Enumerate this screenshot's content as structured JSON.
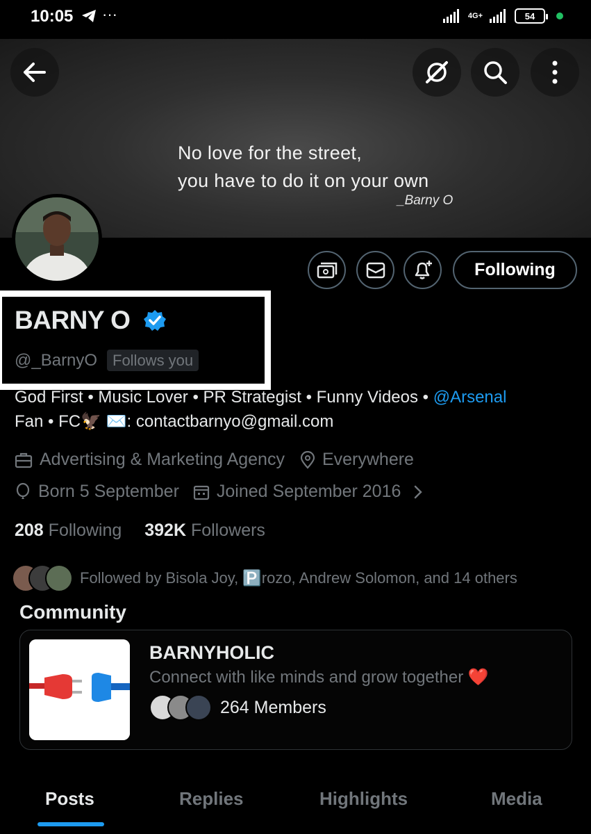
{
  "status_bar": {
    "time": "10:05",
    "dots": "···",
    "network": "4G+",
    "battery": "54"
  },
  "banner": {
    "quote_line1": "No love for the street,",
    "quote_line2": "you have to do it on your own",
    "signature": "_Barny O"
  },
  "actions": {
    "follow_label": "Following"
  },
  "profile": {
    "name": "BARNY O",
    "handle": "@_BarnyO",
    "follows_you": "Follows you",
    "bio_line1_text": "God First • Music Lover • PR Strategist • Funny Videos • ",
    "bio_line1_link": "@Arsenal",
    "bio_line2": "Fan • FC🦅 ✉️: contactbarnyo@gmail.com",
    "category": "Advertising & Marketing Agency",
    "location": "Everywhere",
    "born": "Born 5 September",
    "joined": "Joined September 2016",
    "following_count": "208",
    "following_label": "Following",
    "followers_count": "392K",
    "followers_label": "Followers",
    "followed_by": "Followed by Bisola Joy, 🅿️rozo, Andrew Solomon, and 14 others"
  },
  "community": {
    "section_title": "Community",
    "name": "BARNYHOLIC",
    "description": "Connect with like minds and grow together ❤️",
    "members": "264 Members"
  },
  "tabs": {
    "posts": "Posts",
    "replies": "Replies",
    "highlights": "Highlights",
    "media": "Media"
  },
  "colors": {
    "accent": "#1d9bf0",
    "muted": "#71767b",
    "border": "#536471"
  }
}
